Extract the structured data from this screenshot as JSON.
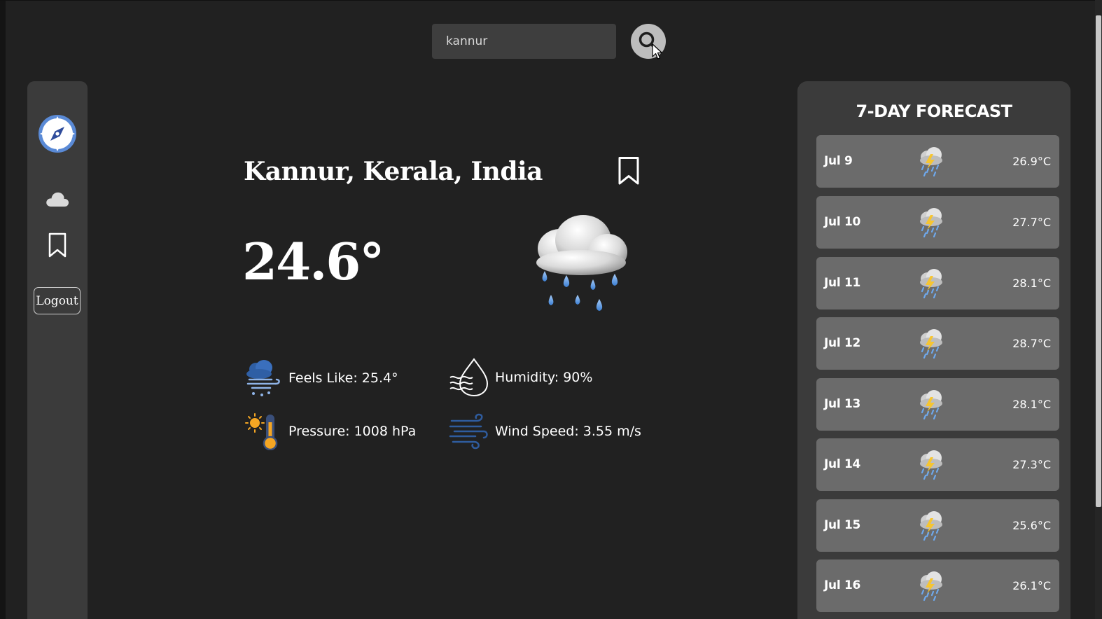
{
  "search": {
    "value": "kannur"
  },
  "sidebar": {
    "logout_label": "Logout"
  },
  "weather": {
    "location": "Kannur, Kerala, India",
    "temperature": "24.6°",
    "condition_icon": "rain-cloud-icon",
    "details": {
      "feels_like": "Feels Like: 25.4°",
      "humidity": "Humidity: 90%",
      "pressure": "Pressure: 1008 hPa",
      "wind_speed": "Wind Speed: 3.55 m/s"
    }
  },
  "forecast": {
    "title": "7-DAY FORECAST",
    "days": [
      {
        "date": "Jul 9",
        "temp": "26.9°C",
        "icon": "thunderstorm-icon"
      },
      {
        "date": "Jul 10",
        "temp": "27.7°C",
        "icon": "thunderstorm-icon"
      },
      {
        "date": "Jul 11",
        "temp": "28.1°C",
        "icon": "thunderstorm-icon"
      },
      {
        "date": "Jul 12",
        "temp": "28.7°C",
        "icon": "thunderstorm-icon"
      },
      {
        "date": "Jul 13",
        "temp": "28.1°C",
        "icon": "thunderstorm-icon"
      },
      {
        "date": "Jul 14",
        "temp": "27.3°C",
        "icon": "thunderstorm-icon"
      },
      {
        "date": "Jul 15",
        "temp": "25.6°C",
        "icon": "thunderstorm-icon"
      },
      {
        "date": "Jul 16",
        "temp": "26.1°C",
        "icon": "thunderstorm-icon"
      }
    ]
  },
  "colors": {
    "background": "#212121",
    "panel": "#3b3b3b",
    "forecast_row": "#6b6b6b",
    "search_input": "#3e3e3e",
    "search_button": "#bdbdbd"
  }
}
